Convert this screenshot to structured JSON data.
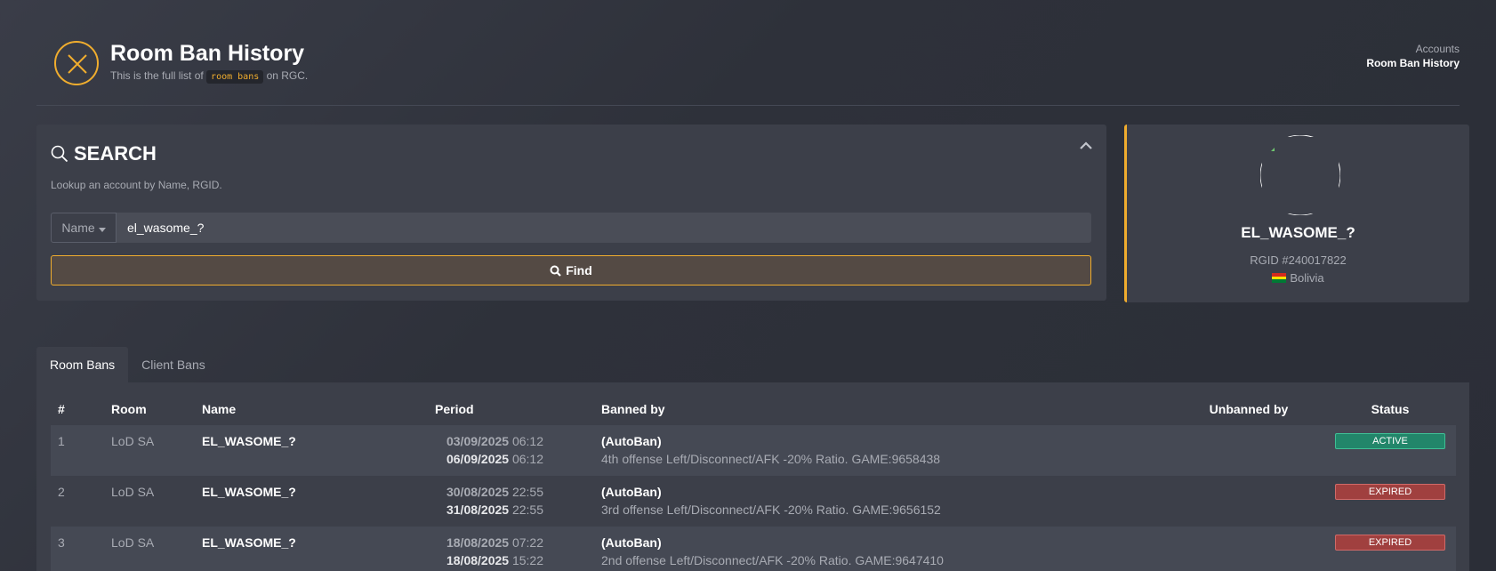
{
  "header": {
    "title": "Room Ban History",
    "subtitle_prefix": "This is the full list of",
    "subtitle_code": "room bans",
    "subtitle_suffix": "on RGC.",
    "breadcrumb": [
      "Accounts",
      "Room Ban History"
    ]
  },
  "search": {
    "title": "SEARCH",
    "description": "Lookup an account by Name, RGID.",
    "dropdown_label": "Name",
    "input_value": "el_wasome_?",
    "find_label": "Find"
  },
  "profile": {
    "name": "EL_WASOME_?",
    "rgid": "RGID #240017822",
    "country": "Bolivia"
  },
  "tabs": [
    "Room Bans",
    "Client Bans"
  ],
  "table": {
    "columns": [
      "#",
      "Room",
      "Name",
      "Period",
      "Banned by",
      "Unbanned by",
      "Status"
    ],
    "rows": [
      {
        "num": "1",
        "room": "LoD SA",
        "name": "EL_WASOME_?",
        "start_date": "03/09/2025",
        "start_time": "06:12",
        "end_date": "06/09/2025",
        "end_time": "06:12",
        "banned_by": "(AutoBan)",
        "reason": "4th offense Left/Disconnect/AFK -20% Ratio. GAME:9658438",
        "unbanned_by": "",
        "status": "ACTIVE"
      },
      {
        "num": "2",
        "room": "LoD SA",
        "name": "EL_WASOME_?",
        "start_date": "30/08/2025",
        "start_time": "22:55",
        "end_date": "31/08/2025",
        "end_time": "22:55",
        "banned_by": "(AutoBan)",
        "reason": "3rd offense Left/Disconnect/AFK -20% Ratio. GAME:9656152",
        "unbanned_by": "",
        "status": "EXPIRED"
      },
      {
        "num": "3",
        "room": "LoD SA",
        "name": "EL_WASOME_?",
        "start_date": "18/08/2025",
        "start_time": "07:22",
        "end_date": "18/08/2025",
        "end_time": "15:22",
        "banned_by": "(AutoBan)",
        "reason": "2nd offense Left/Disconnect/AFK -20% Ratio. GAME:9647410",
        "unbanned_by": "",
        "status": "EXPIRED"
      }
    ]
  },
  "colors": {
    "accent": "#f0ad2e",
    "active": "#22866a",
    "expired": "#a0403f"
  }
}
